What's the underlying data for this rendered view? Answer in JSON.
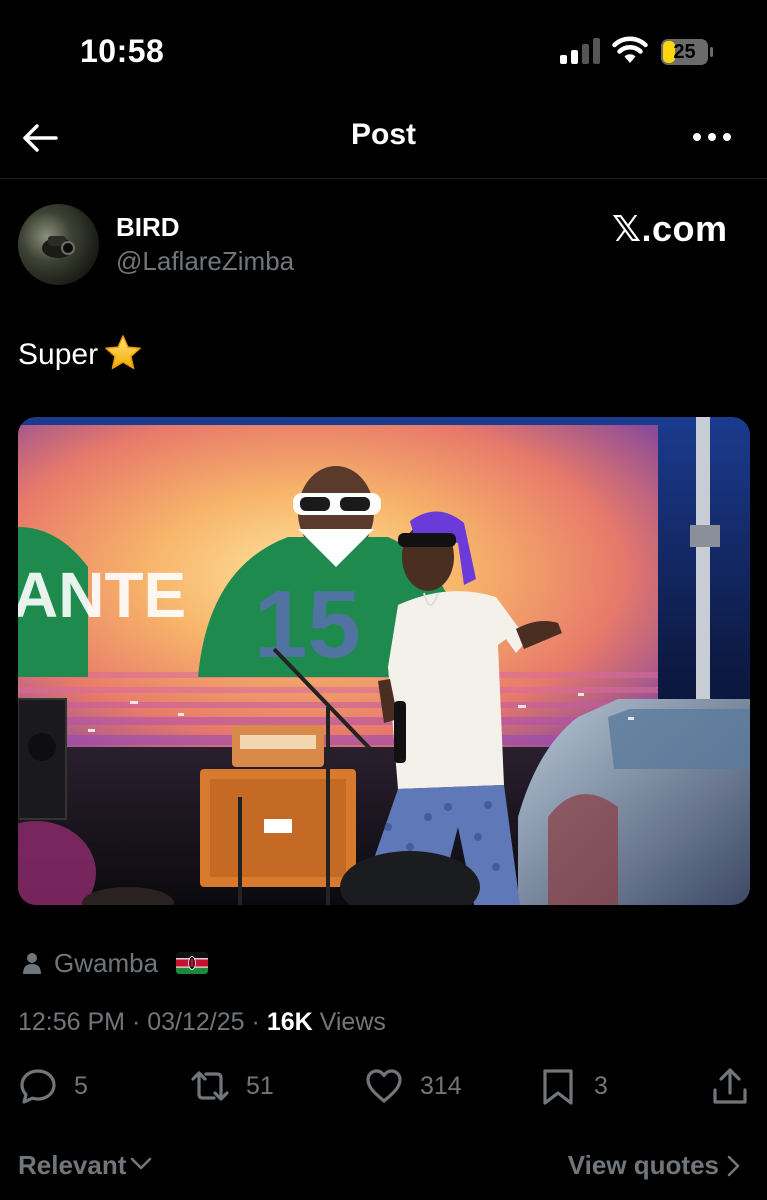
{
  "status_bar": {
    "time": "10:58",
    "battery": "25"
  },
  "header": {
    "title": "Post"
  },
  "author": {
    "name": "BIRD",
    "handle": "@LaflareZimba"
  },
  "brand": "𝕏.com",
  "post": {
    "text": "Super"
  },
  "tag": {
    "name": "Gwamba"
  },
  "meta": {
    "time": "12:56 PM",
    "date": "03/12/25",
    "views_count": "16K",
    "views_label": "Views"
  },
  "actions": {
    "replies": "5",
    "reposts": "51",
    "likes": "314",
    "bookmarks": "3"
  },
  "footer": {
    "sort_label": "Relevant",
    "view_quotes": "View quotes"
  },
  "colors": {
    "background": "#000000",
    "text": "#ffffff",
    "muted": "#71767b",
    "battery": "#ffd60a"
  }
}
